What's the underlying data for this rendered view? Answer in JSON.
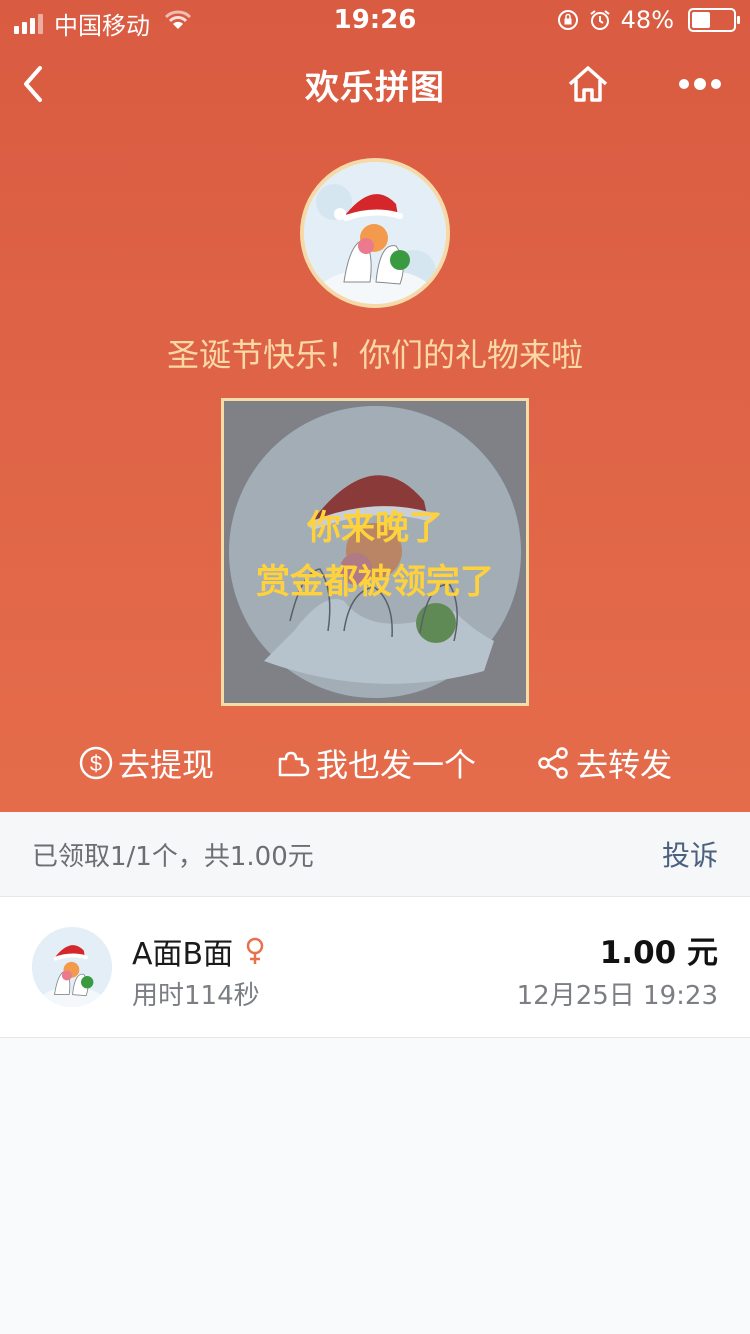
{
  "status_bar": {
    "carrier": "中国移动",
    "time": "19:26",
    "battery": "48%"
  },
  "nav": {
    "title": "欢乐拼图"
  },
  "greeting": "圣诞节快乐！你们的礼物来啦",
  "puzzle": {
    "message_line1": "你来晚了",
    "message_line2": "赏金都被领完了"
  },
  "actions": {
    "withdraw": "去提现",
    "send_one": "我也发一个",
    "share": "去转发"
  },
  "summary": {
    "text": "已领取1/1个，共1.00元",
    "complain": "投诉"
  },
  "records": [
    {
      "name": "A面B面",
      "gender": "female",
      "time_used": "用时114秒",
      "amount": "1.00 元",
      "date": "12月25日 19:23"
    }
  ],
  "colors": {
    "header_bg": "#d95b41",
    "greeting": "#fbd9a6",
    "puzzle_text": "#ffd23b",
    "complain_link": "#4a6180",
    "gender_icon": "#e8704f"
  }
}
